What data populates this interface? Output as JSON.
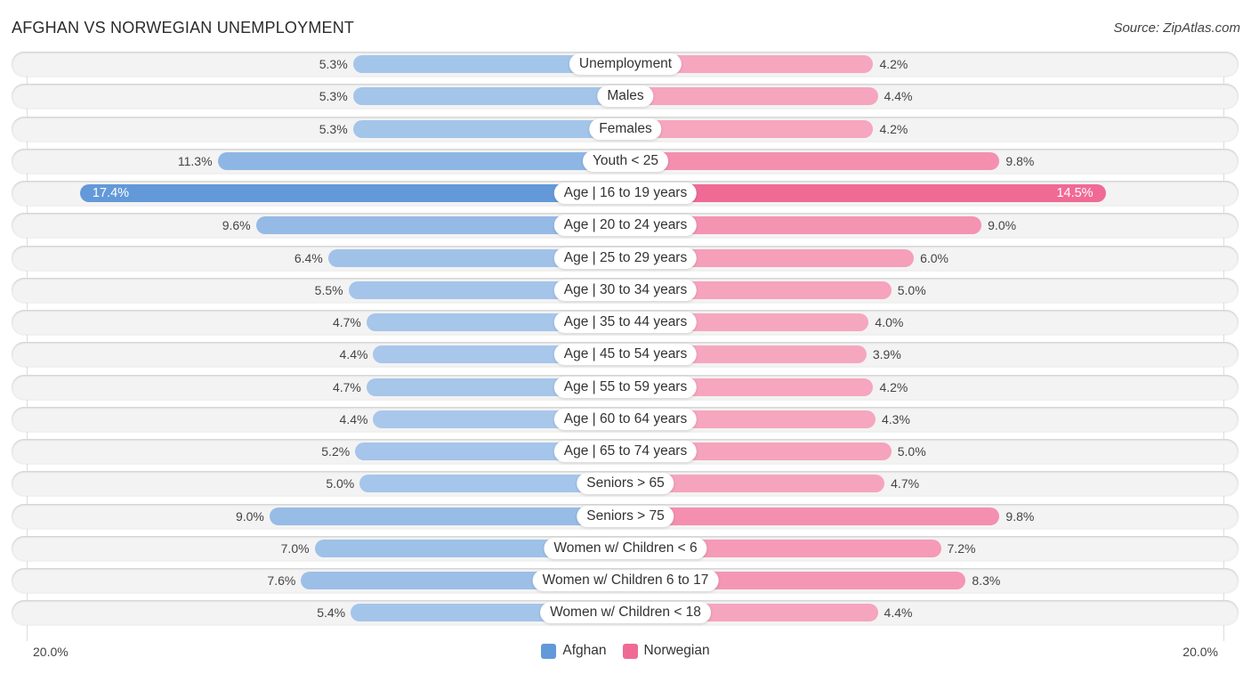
{
  "header": {
    "title": "AFGHAN VS NORWEGIAN UNEMPLOYMENT",
    "source": "Source: ZipAtlas.com"
  },
  "colors": {
    "afghan_strong": "#6399d9",
    "afghan_light": "#a9c8eb",
    "norwegian_strong": "#f06a96",
    "norwegian_light": "#f6a7c0"
  },
  "chart_data": {
    "type": "bar",
    "orientation": "horizontal-diverging",
    "title": "AFGHAN VS NORWEGIAN UNEMPLOYMENT",
    "categories": [
      "Unemployment",
      "Males",
      "Females",
      "Youth < 25",
      "Age | 16 to 19 years",
      "Age | 20 to 24 years",
      "Age | 25 to 29 years",
      "Age | 30 to 34 years",
      "Age | 35 to 44 years",
      "Age | 45 to 54 years",
      "Age | 55 to 59 years",
      "Age | 60 to 64 years",
      "Age | 65 to 74 years",
      "Seniors > 65",
      "Seniors > 75",
      "Women w/ Children < 6",
      "Women w/ Children 6 to 17",
      "Women w/ Children < 18"
    ],
    "series": [
      {
        "name": "Afghan",
        "side": "left",
        "values": [
          5.3,
          5.3,
          5.3,
          11.3,
          17.4,
          9.6,
          6.4,
          5.5,
          4.7,
          4.4,
          4.7,
          4.4,
          5.2,
          5.0,
          9.0,
          7.0,
          7.6,
          5.4
        ],
        "labels": [
          "5.3%",
          "5.3%",
          "5.3%",
          "11.3%",
          "17.4%",
          "9.6%",
          "6.4%",
          "5.5%",
          "4.7%",
          "4.4%",
          "4.7%",
          "4.4%",
          "5.2%",
          "5.0%",
          "9.0%",
          "7.0%",
          "7.6%",
          "5.4%"
        ]
      },
      {
        "name": "Norwegian",
        "side": "right",
        "values": [
          4.2,
          4.4,
          4.2,
          9.8,
          14.5,
          9.0,
          6.0,
          5.0,
          4.0,
          3.9,
          4.2,
          4.3,
          5.0,
          4.7,
          9.8,
          7.2,
          8.3,
          4.4
        ],
        "labels": [
          "4.2%",
          "4.4%",
          "4.2%",
          "9.8%",
          "14.5%",
          "9.0%",
          "6.0%",
          "5.0%",
          "4.0%",
          "3.9%",
          "4.2%",
          "4.3%",
          "5.0%",
          "4.7%",
          "9.8%",
          "7.2%",
          "8.3%",
          "4.4%"
        ]
      }
    ],
    "axis": {
      "min_label": "20.0%",
      "max_label": "20.0%",
      "range": [
        0,
        20
      ]
    },
    "legend": {
      "position": "bottom-center",
      "items": [
        "Afghan",
        "Norwegian"
      ]
    },
    "grid": false
  }
}
